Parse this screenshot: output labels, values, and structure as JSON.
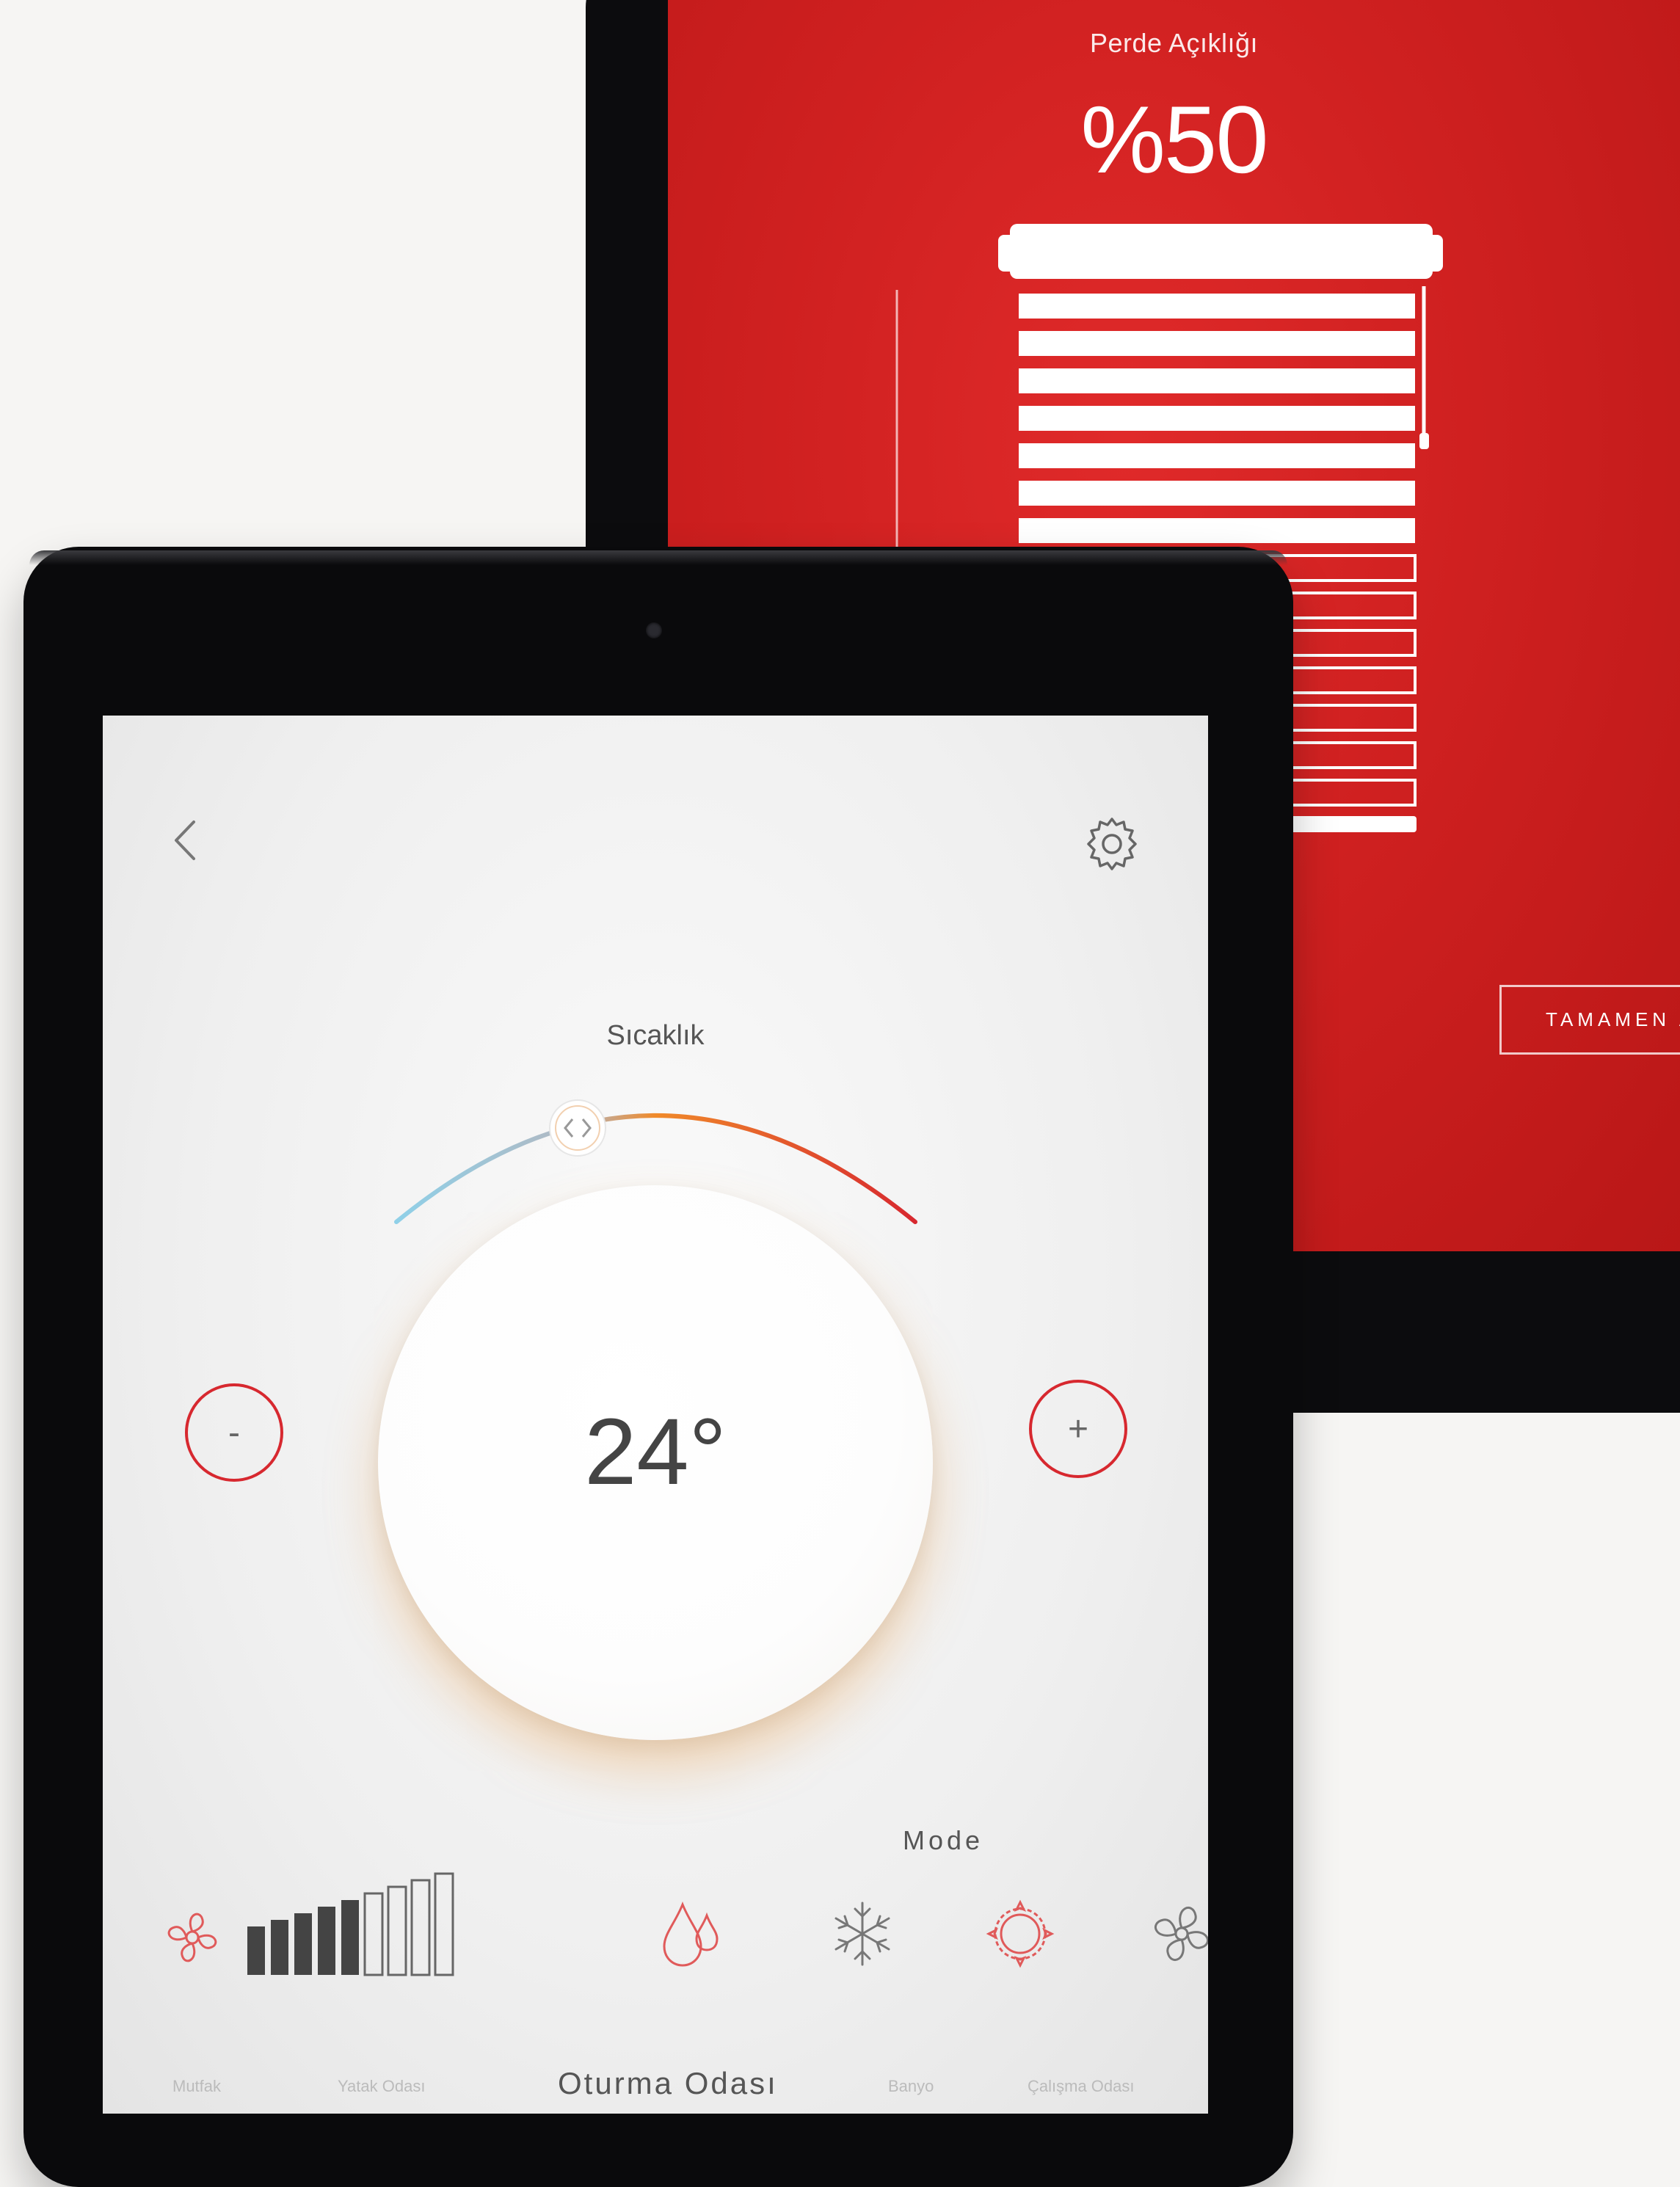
{
  "curtain_screen": {
    "title": "Perde Açıklığı",
    "value": "%50",
    "open_level_percent": 50,
    "button_label": "TAMAMEN A"
  },
  "thermostat_screen": {
    "label": "Sıcaklık",
    "temperature": "24°",
    "minus_label": "-",
    "plus_label": "+",
    "mode_label": "Mode",
    "fan_speed_level": 5,
    "fan_speed_max": 9,
    "mode_icons": [
      "fan-icon",
      "drop-icon",
      "snowflake-icon",
      "sun-icon",
      "fan-mode-icon"
    ],
    "rooms": [
      "Mutfak",
      "Yatak Odası",
      "Oturma Odası",
      "Banyo",
      "Çalışma Odası"
    ],
    "active_room": "Oturma Odası"
  },
  "colors": {
    "accent_red": "#d7282f",
    "back_screen_red": "#cf2020",
    "bezel": "#0a0a0c"
  }
}
